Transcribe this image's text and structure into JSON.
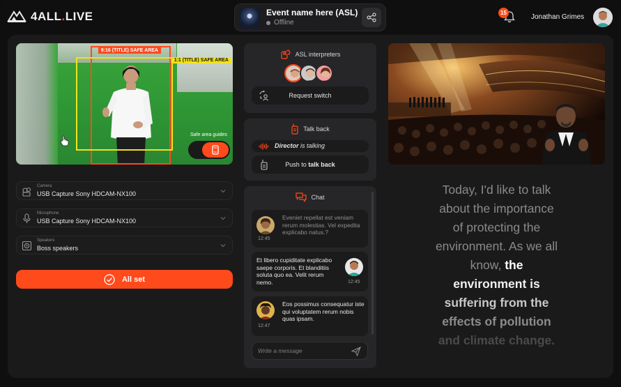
{
  "app": {
    "logo_text": "4ALL",
    "logo_dot": ".",
    "logo_suffix": "LIVE"
  },
  "event": {
    "title": "Event name here (ASL)",
    "status": "Offline"
  },
  "notifications": {
    "count": "15"
  },
  "user": {
    "name": "Jonathan Grimes"
  },
  "camera_preview": {
    "safe_area_916": "9:16 (TITLE) SAFE AREA",
    "safe_area_11": "1:1 (TITLE) SAFE AREA",
    "guides_label": "Safe area guides"
  },
  "devices": [
    {
      "label": "Camera",
      "value": "USB Capture Sony HDCAM-NX100",
      "icon": "camera-icon"
    },
    {
      "label": "Microphone",
      "value": "USB Capture Sony HDCAM-NX100",
      "icon": "microphone-icon"
    },
    {
      "label": "Speakers",
      "value": "Boss speakers",
      "icon": "speaker-icon"
    }
  ],
  "all_set_label": "All set",
  "interpreters": {
    "title": "ASL interpreters",
    "request_switch": "Request switch"
  },
  "talkback": {
    "title": "Talk back",
    "status_who": "Director",
    "status_rest": " is talking",
    "push_prefix": "Push to ",
    "push_bold": "talk back"
  },
  "chat": {
    "title": "Chat",
    "messages": [
      {
        "text": "Eveniet repellat est veniam rerum molestias. Vel expedita explicabo natus.?",
        "time": "12:45",
        "side": "left"
      },
      {
        "text": "Et libero cupiditate explicabo saepe corporis. Et blanditiis soluta quo ea. Velit rerum nemo.",
        "time": "12:45",
        "side": "right"
      },
      {
        "text": "Eos possimus consequatur iste qui voluptatem rerum nobis quas ipsam.",
        "time": "12:47",
        "side": "left"
      }
    ],
    "placeholder": "Write a message"
  },
  "captions": {
    "line1": "Today, I'd like to talk",
    "line2": "about the importance",
    "line3": "of protecting the",
    "line4": "environment. As we all",
    "line5_plain": "know, ",
    "line5_bold": "the",
    "line6": "environment is",
    "line7": "suffering from the",
    "line8": "effects of pollution",
    "line9": "and climate change."
  },
  "colors": {
    "accent": "#ff4a1c",
    "safe_yellow": "#f1e21d",
    "panel": "#1a1a1b",
    "card": "#262628"
  }
}
